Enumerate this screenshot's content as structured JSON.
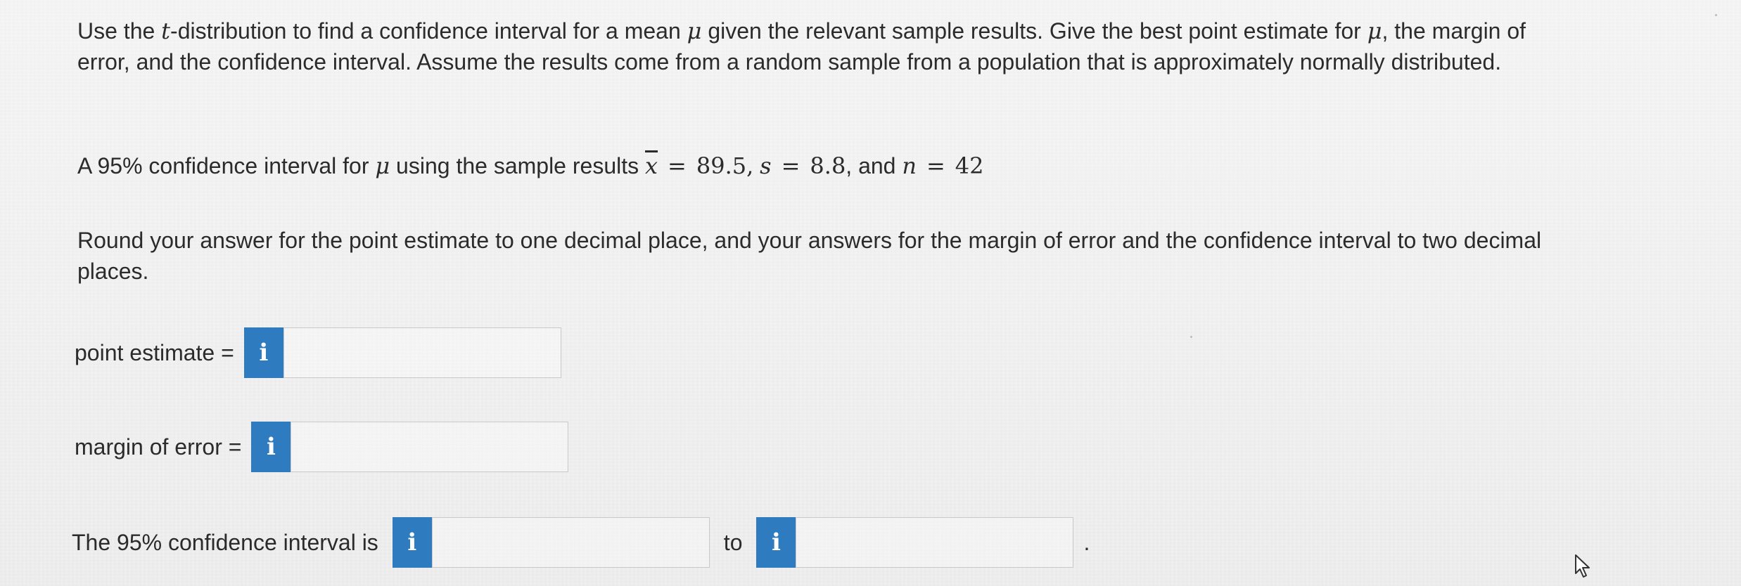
{
  "question": {
    "intro_prefix": "Use the ",
    "intro_t": "t",
    "intro_after_t": "-distribution to find a confidence interval for a mean ",
    "mu": "μ",
    "intro_mid": " given the relevant sample results. Give the best point estimate for ",
    "intro_comma": ",",
    "intro_rest": " the margin of error, and the confidence interval. Assume the results come from a random sample from a population that is approximately normally distributed.",
    "sample_prefix": "A 95% confidence interval for ",
    "sample_mid": " using the sample results ",
    "xbar_symbol": "x",
    "equals": "=",
    "xbar_value": "89.5",
    "comma": ",",
    "s_symbol": "s",
    "s_value": "8.8",
    "and_text": ", and ",
    "n_symbol": "n",
    "n_value": "42",
    "rounding_instructions": "Round your answer for the point estimate to one decimal place, and your answers for the margin of error and the confidence interval to two decimal places."
  },
  "answers": {
    "point_estimate_label": "point estimate =",
    "point_estimate_value": "",
    "margin_of_error_label": "margin of error =",
    "margin_of_error_value": "",
    "interval_label": "The 95% confidence interval is",
    "interval_lower_value": "",
    "interval_to": "to",
    "interval_upper_value": "",
    "interval_period": "."
  },
  "icons": {
    "info_glyph": "i",
    "info_color": "#2e7cbf"
  }
}
